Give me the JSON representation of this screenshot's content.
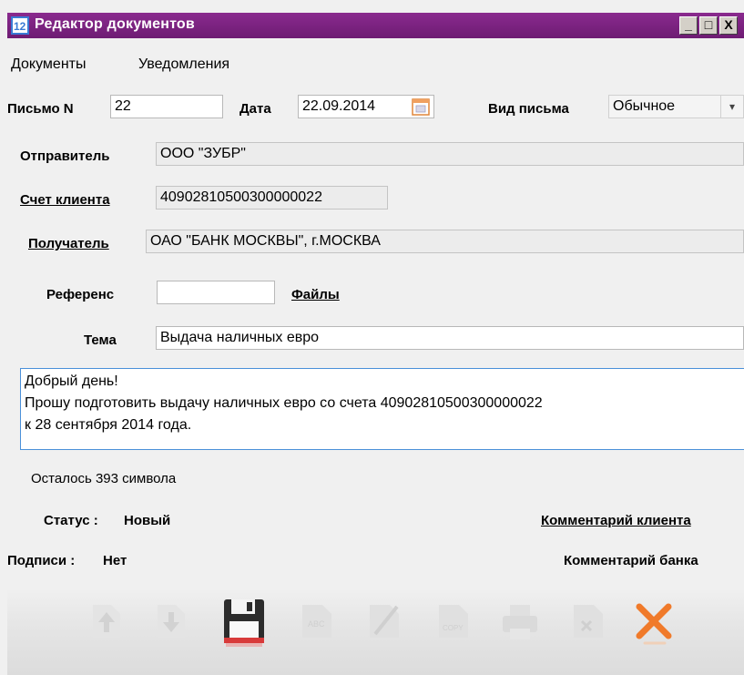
{
  "window": {
    "title": "Редактор документов"
  },
  "menu": [
    "Документы",
    "Уведомления"
  ],
  "form": {
    "letter_no_label": "Письмо N",
    "letter_no": "22",
    "date_label": "Дата",
    "date": "22.09.2014",
    "type_label": "Вид письма",
    "type_value": "Обычное",
    "sender_label": "Отправитель",
    "sender": "ООО \"ЗУБР\"",
    "account_label": "Счет клиента",
    "account": "40902810500300000022",
    "recipient_label": "Получатель",
    "recipient": "ОАО \"БАНК МОСКВЫ\", г.МОСКВА",
    "reference_label": "Референс",
    "reference": "",
    "files_label": "Файлы",
    "subject_label": "Тема",
    "subject": "Выдача наличных евро",
    "body_lines": [
      "Добрый день!",
      "Прошу подготовить выдачу наличных евро со счета 40902810500300000022",
      "к 28 сентября 2014 года."
    ],
    "remaining": "Осталось 393 символа"
  },
  "status": {
    "status_label": "Статус :",
    "status_value": "Новый",
    "sign_label": "Подписи :",
    "sign_value": "Нет",
    "client_comment": "Комментарий клиента",
    "bank_comment": "Комментарий банка"
  },
  "toolbar": {
    "icons": [
      "arrow-up-icon",
      "arrow-down-icon",
      "save-icon",
      "document-icon",
      "sign-icon",
      "copy-icon",
      "print-icon",
      "delete-document-icon",
      "close-icon"
    ]
  },
  "colors": {
    "titlebar": "#7a2280",
    "focus_border": "#4a90d9",
    "close_orange": "#f07a2a"
  }
}
